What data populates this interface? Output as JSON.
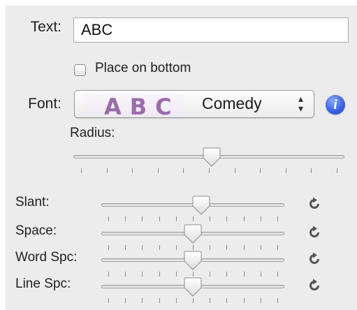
{
  "text_row": {
    "label": "Text:",
    "value": "ABC"
  },
  "checkbox": {
    "label": "Place on bottom",
    "checked": false
  },
  "font_row": {
    "label": "Font:",
    "preview_text": "ABC",
    "selected_font": "Comedy",
    "preview_color": "#9a6cab"
  },
  "info_button": {
    "glyph": "i"
  },
  "radius": {
    "label": "Radius:",
    "value": 0.51,
    "ticks": 11
  },
  "sliders": [
    {
      "label": "Slant:",
      "value": 0.55,
      "ticks": 11,
      "reset_icon": "reset-icon"
    },
    {
      "label": "Space:",
      "value": 0.5,
      "ticks": 11,
      "reset_icon": "reset-icon"
    },
    {
      "label": "Word Spc:",
      "value": 0.5,
      "ticks": 11,
      "reset_icon": "reset-icon"
    },
    {
      "label": "Line Spc:",
      "value": 0.5,
      "ticks": 11,
      "reset_icon": "reset-icon"
    }
  ]
}
